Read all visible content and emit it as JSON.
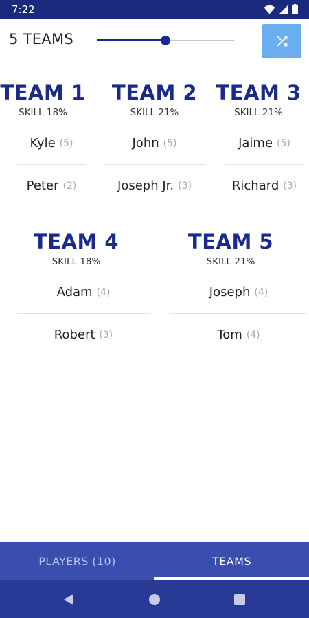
{
  "status_bar": {
    "time": "7:22"
  },
  "header": {
    "team_count_label": "5 TEAMS",
    "slider_value": 0.5
  },
  "teams_row1": [
    {
      "name": "TEAM 1",
      "skill": "SKILL 18%",
      "players": [
        {
          "name": "Kyle",
          "skill": "(5)"
        },
        {
          "name": "Peter",
          "skill": "(2)"
        }
      ]
    },
    {
      "name": "TEAM 2",
      "skill": "SKILL 21%",
      "players": [
        {
          "name": "John",
          "skill": "(5)"
        },
        {
          "name": "Joseph Jr.",
          "skill": "(3)"
        }
      ]
    },
    {
      "name": "TEAM 3",
      "skill": "SKILL 21%",
      "players": [
        {
          "name": "Jaime",
          "skill": "(5)"
        },
        {
          "name": "Richard",
          "skill": "(3)"
        }
      ]
    }
  ],
  "teams_row2": [
    {
      "name": "TEAM 4",
      "skill": "SKILL 18%",
      "players": [
        {
          "name": "Adam",
          "skill": "(4)"
        },
        {
          "name": "Robert",
          "skill": "(3)"
        }
      ]
    },
    {
      "name": "TEAM 5",
      "skill": "SKILL 21%",
      "players": [
        {
          "name": "Joseph",
          "skill": "(4)"
        },
        {
          "name": "Tom",
          "skill": "(4)"
        }
      ]
    }
  ],
  "tabs": [
    {
      "label": "PLAYERS (10)",
      "active": false
    },
    {
      "label": "TEAMS",
      "active": true
    }
  ],
  "colors": {
    "accent": "#1a2a8a",
    "shuffle_button": "#6aaef0",
    "tab_bar": "#3b4eb0",
    "status_bar": "#1a2a7d"
  },
  "icons": {
    "shuffle": "shuffle-icon",
    "wifi": "wifi-icon",
    "signal": "signal-icon",
    "battery": "battery-icon",
    "back": "back-icon",
    "home": "home-icon",
    "recents": "recents-icon"
  }
}
